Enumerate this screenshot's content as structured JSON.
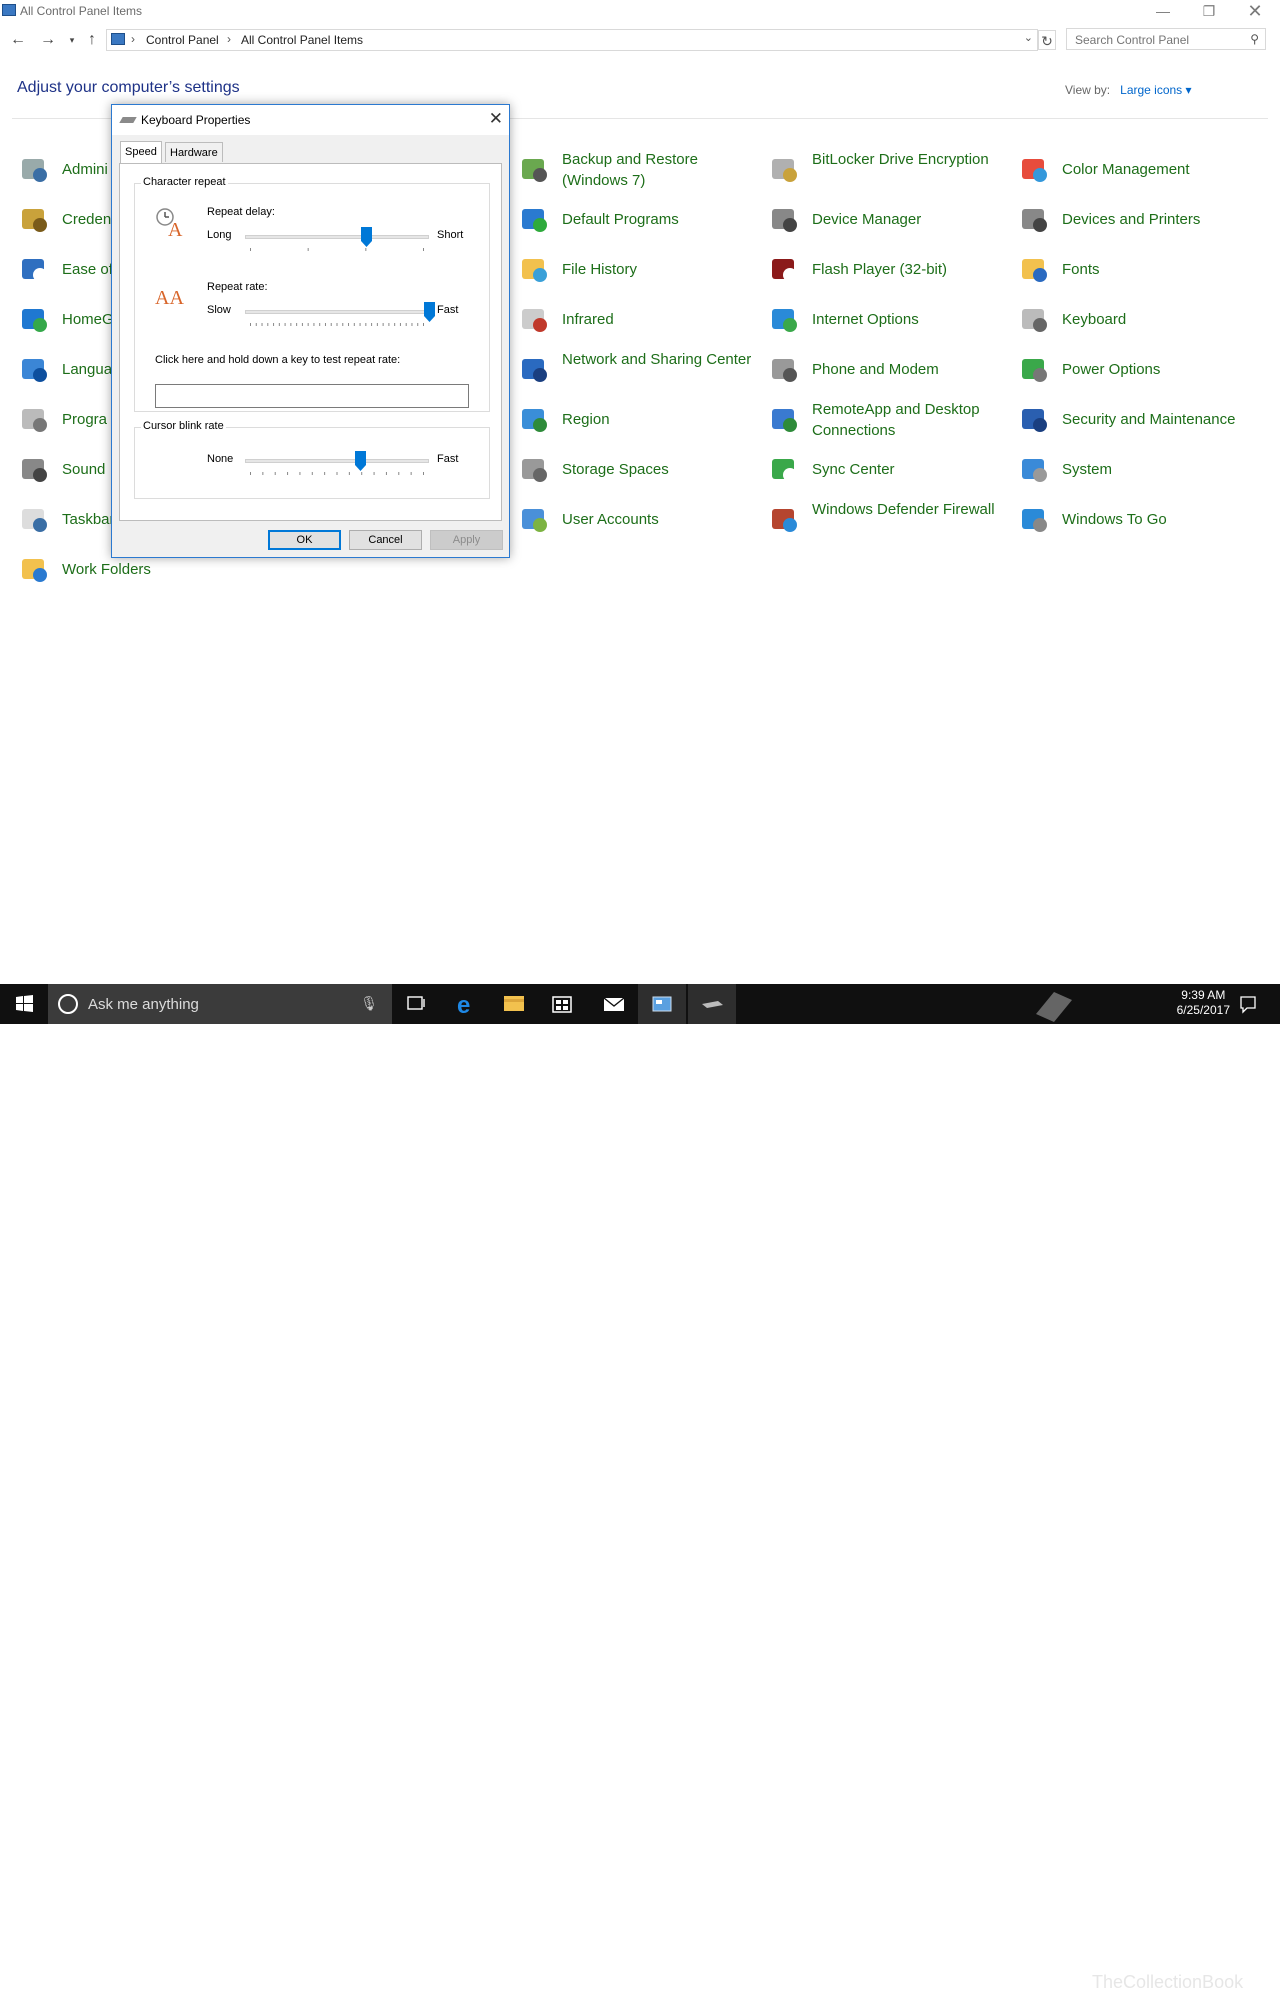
{
  "window": {
    "title": "All Control Panel Items"
  },
  "address": {
    "crumbs": [
      "Control Panel",
      "All Control Panel Items"
    ],
    "separator": "›",
    "search_placeholder": "Search Control Panel"
  },
  "header": {
    "heading": "Adjust your computer’s settings",
    "view_by_label": "View by:",
    "view_by_value": "Large icons ▾"
  },
  "items": [
    {
      "label": "Admini",
      "icon": "administrative-tools-icon"
    },
    {
      "label": "Creden",
      "icon": "credential-manager-icon"
    },
    {
      "label": "Ease of",
      "icon": "ease-of-access-icon"
    },
    {
      "label": "HomeG",
      "icon": "homegroup-icon"
    },
    {
      "label": "Langua",
      "icon": "language-icon"
    },
    {
      "label": "Progra",
      "icon": "programs-icon"
    },
    {
      "label": "Sound",
      "icon": "sound-icon"
    },
    {
      "label": "Taskbar",
      "icon": "taskbar-icon"
    },
    {
      "label": "Work Folders",
      "icon": "work-folders-icon"
    },
    {
      "label": "Backup and Restore (Windows 7)",
      "icon": "backup-restore-icon"
    },
    {
      "label": "Default Programs",
      "icon": "default-programs-icon"
    },
    {
      "label": "File History",
      "icon": "file-history-icon"
    },
    {
      "label": "Infrared",
      "icon": "infrared-icon"
    },
    {
      "label": "Network and Sharing Center",
      "icon": "network-sharing-icon"
    },
    {
      "label": "Region",
      "icon": "region-icon"
    },
    {
      "label": "Storage Spaces",
      "icon": "storage-spaces-icon"
    },
    {
      "label": "User Accounts",
      "icon": "user-accounts-icon"
    },
    {
      "label": "BitLocker Drive Encryption",
      "icon": "bitlocker-icon"
    },
    {
      "label": "Device Manager",
      "icon": "device-manager-icon"
    },
    {
      "label": "Flash Player (32-bit)",
      "icon": "flash-player-icon"
    },
    {
      "label": "Internet Options",
      "icon": "internet-options-icon"
    },
    {
      "label": "Phone and Modem",
      "icon": "phone-modem-icon"
    },
    {
      "label": "RemoteApp and Desktop Connections",
      "icon": "remoteapp-icon"
    },
    {
      "label": "Sync Center",
      "icon": "sync-center-icon"
    },
    {
      "label": "Windows Defender Firewall",
      "icon": "firewall-icon"
    },
    {
      "label": "Color Management",
      "icon": "color-management-icon"
    },
    {
      "label": "Devices and Printers",
      "icon": "devices-printers-icon"
    },
    {
      "label": "Fonts",
      "icon": "fonts-icon"
    },
    {
      "label": "Keyboard",
      "icon": "keyboard-icon"
    },
    {
      "label": "Power Options",
      "icon": "power-options-icon"
    },
    {
      "label": "Security and Maintenance",
      "icon": "security-maintenance-icon"
    },
    {
      "label": "System",
      "icon": "system-icon"
    },
    {
      "label": "Windows To Go",
      "icon": "windows-to-go-icon"
    }
  ],
  "dialog": {
    "title": "Keyboard Properties",
    "tabs": [
      "Speed",
      "Hardware"
    ],
    "char_repeat": "Character repeat",
    "repeat_delay": {
      "label": "Repeat delay:",
      "min": "Long",
      "max": "Short",
      "value_fraction": 0.66
    },
    "repeat_rate": {
      "label": "Repeat rate:",
      "min": "Slow",
      "max": "Fast",
      "value_fraction": 1.0
    },
    "test_label": "Click here and hold down a key to test repeat rate:",
    "test_value": "",
    "cursor_blink": {
      "label": "Cursor blink rate",
      "min": "None",
      "max": "Fast",
      "value_fraction": 0.63
    },
    "buttons": {
      "ok": "OK",
      "cancel": "Cancel",
      "apply": "Apply"
    }
  },
  "taskbar": {
    "search_text": "Ask me anything",
    "time": "9:39 AM",
    "date": "6/25/2017"
  },
  "watermark": "TheCollectionBook"
}
